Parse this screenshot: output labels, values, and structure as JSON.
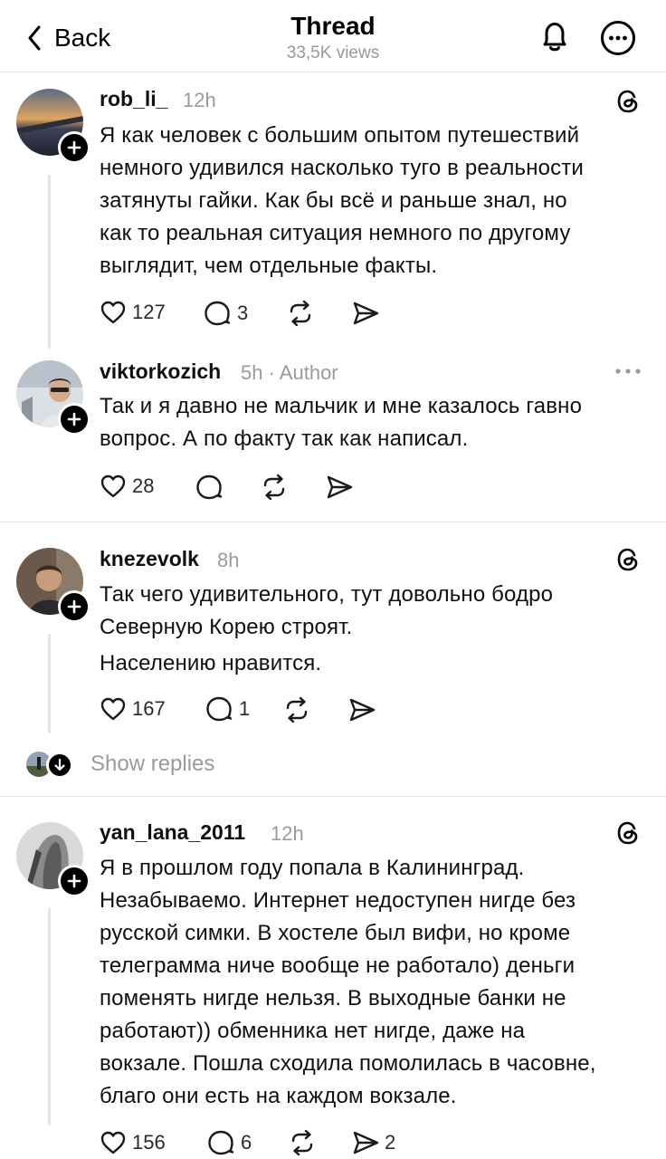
{
  "header": {
    "back_label": "Back",
    "title": "Thread",
    "views": "33,5K views"
  },
  "posts": [
    {
      "username": "rob_li_",
      "time": "12h",
      "lines": [
        "Я как человек с большим опытом путешествий",
        "немного удивился насколько туго в реальности",
        "затянуты гайки. Как бы всё и раньше знал, но",
        "как то реальная ситуация немного по другому",
        "выглядит, чем отдельные факты."
      ],
      "likes": "127",
      "replies": "3",
      "reposts": "",
      "shares": ""
    },
    {
      "username": "viktorkozich",
      "time": "5h · Author",
      "lines": [
        "Так и я давно не мальчик и мне казалось гавно",
        "вопрос. А по факту так как написал."
      ],
      "likes": "28",
      "replies": "",
      "reposts": "",
      "shares": ""
    },
    {
      "username": "knezevolk",
      "time": "8h",
      "lines": [
        "Так чего удивительного, тут довольно бодро",
        "Северную Корею строят."
      ],
      "lines2": [
        "Населению нравится."
      ],
      "likes": "167",
      "replies": "1",
      "reposts": "",
      "shares": ""
    },
    {
      "username": "yan_lana_2011",
      "time": "12h",
      "lines": [
        "Я в прошлом году попала в Калининград.",
        "Незабываемо. Интернет недоступен нигде без",
        "русской симки. В хостеле был вифи, но кроме",
        "телеграмма ниче вообще не работало) деньги",
        "поменять нигде нельзя. В выходные банки не",
        "работают)) обменника нет нигде, даже на",
        "вокзале. Пошла сходила помолилась в часовне,",
        "благо они есть на каждом вокзале."
      ],
      "likes": "156",
      "replies": "6",
      "reposts": "",
      "shares": "2"
    }
  ],
  "show_replies_label": "Show replies",
  "icons": [
    "chevron-left-icon",
    "bell-icon",
    "more-circle-icon",
    "threads-logo-icon",
    "heart-icon",
    "comment-icon",
    "repost-icon",
    "share-icon",
    "plus-icon",
    "more-horizontal-icon",
    "arrow-down-icon"
  ],
  "colors": {
    "text": "#101010",
    "muted": "#9a9a9a",
    "divider": "#e2e2e2",
    "line": "#e5e5e5"
  }
}
